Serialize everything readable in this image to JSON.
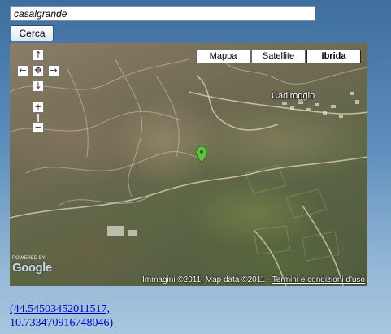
{
  "search": {
    "value": "casalgrande",
    "button_label": "Cerca"
  },
  "map": {
    "type_buttons": [
      "Mappa",
      "Satellite",
      "Ibrida"
    ],
    "active_type": "Ibrida",
    "place_label": "Cadiroggio",
    "logo_text": "Google",
    "powered_text": "POWERED BY",
    "attribution": "Immagini ©2011, Map data ©2011 - ",
    "terms_link": "Termini e condizioni d'uso",
    "controls": {
      "pan_up": "↑",
      "pan_left": "←",
      "pan_center": "✥",
      "pan_right": "→",
      "pan_down": "↓",
      "zoom_in": "+",
      "zoom_out": "−"
    },
    "marker_color": "#5fc241"
  },
  "coords": {
    "line1": "(44.54503452011517,",
    "line2": "10.733470916748046)"
  }
}
